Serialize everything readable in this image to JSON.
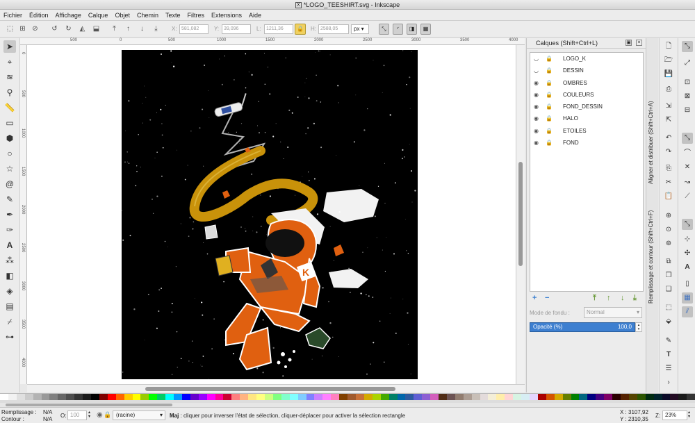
{
  "window": {
    "title": "*LOGO_TEESHIRT.svg - Inkscape",
    "app_icon": "x-icon"
  },
  "menu": [
    "Fichier",
    "Édition",
    "Affichage",
    "Calque",
    "Objet",
    "Chemin",
    "Texte",
    "Filtres",
    "Extensions",
    "Aide"
  ],
  "toolbar": {
    "x_label": "X:",
    "x_value": "581,082",
    "y_label": "Y:",
    "y_value": "39,096",
    "w_label": "L:",
    "w_value": "1211,36",
    "h_label": "H:",
    "h_value": "2588,05",
    "unit": "px"
  },
  "ruler": {
    "top_ticks": [
      "500",
      "0",
      "500",
      "1000",
      "1500",
      "2000",
      "2500",
      "3000",
      "3500",
      "4000"
    ],
    "left_ticks": [
      "0",
      "500",
      "1000",
      "1500",
      "2000",
      "2500",
      "3000",
      "3500",
      "4000"
    ]
  },
  "layers_panel": {
    "title": "Calques (Shift+Ctrl+L)",
    "layers": [
      {
        "name": "LOGO_K",
        "visible": false
      },
      {
        "name": "DESSIN",
        "visible": false
      },
      {
        "name": "OMBRES",
        "visible": true
      },
      {
        "name": "COULEURS",
        "visible": true
      },
      {
        "name": "FOND_DESSIN",
        "visible": true
      },
      {
        "name": "HALO",
        "visible": true
      },
      {
        "name": "ETOILES",
        "visible": true
      },
      {
        "name": "FOND",
        "visible": true
      }
    ],
    "blend_label": "Mode de fondu :",
    "blend_value": "Normal",
    "opacity_label": "Opacité (%)",
    "opacity_value": "100,0",
    "add_glyph": "+",
    "remove_glyph": "−"
  },
  "side_tabs": {
    "align": "Aligner et distribuer (Shift+Ctrl+A)",
    "fill_stroke": "Remplissage et contour (Shift+Ctrl+F)"
  },
  "status": {
    "fill_label": "Remplissage :",
    "fill_value": "N/A",
    "stroke_label": "Contour :",
    "stroke_value": "N/A",
    "opacity_label": "O:",
    "opacity_value": "100",
    "layer_value": "(racine)",
    "message_key": "Maj",
    "message": " : cliquer pour inverser l'état de sélection, cliquer-déplacer pour activer la sélection rectangle",
    "x_coord": "X : 3107,92",
    "y_coord": "Y : 2310,35",
    "zoom_label": "Z:",
    "zoom_value": "23%"
  },
  "palette_colors": [
    "#ffffff",
    "#f2f2f2",
    "#e0e0e0",
    "#cccccc",
    "#b3b3b3",
    "#999999",
    "#808080",
    "#666666",
    "#4d4d4d",
    "#333333",
    "#1a1a1a",
    "#000000",
    "#800000",
    "#ff0000",
    "#ff6600",
    "#ffcc00",
    "#ffff00",
    "#99cc00",
    "#00ff00",
    "#00cc66",
    "#00ffff",
    "#0099ff",
    "#0000ff",
    "#6600cc",
    "#9900ff",
    "#ff00ff",
    "#ff0099",
    "#cc0033",
    "#ff8080",
    "#ffb380",
    "#ffe680",
    "#ffff80",
    "#ccff80",
    "#80ff80",
    "#80ffcc",
    "#80ffff",
    "#80ccff",
    "#8080ff",
    "#cc80ff",
    "#ff80ff",
    "#ff80bf",
    "#804000",
    "#a05a2c",
    "#c87137",
    "#d4aa00",
    "#aad400",
    "#44aa00",
    "#008066",
    "#0066aa",
    "#2c5aa0",
    "#5f5fd3",
    "#8d5fd3",
    "#d35fbc",
    "#502d16",
    "#6c5353",
    "#917c6f",
    "#ac9d93",
    "#c8bfb7",
    "#e3dbdb",
    "#f4eed7",
    "#ffeeaa",
    "#ffd5d5",
    "#d7f4e3",
    "#d7eef4",
    "#e5d5ff",
    "#aa0000",
    "#d45500",
    "#d4aa00",
    "#668000",
    "#008000",
    "#006680",
    "#000080",
    "#440080",
    "#800066",
    "#2b0000",
    "#552200",
    "#554400",
    "#2b5500",
    "#002b11",
    "#00222b",
    "#0b0b28",
    "#220b22",
    "#1a1a1a",
    "#333333"
  ]
}
